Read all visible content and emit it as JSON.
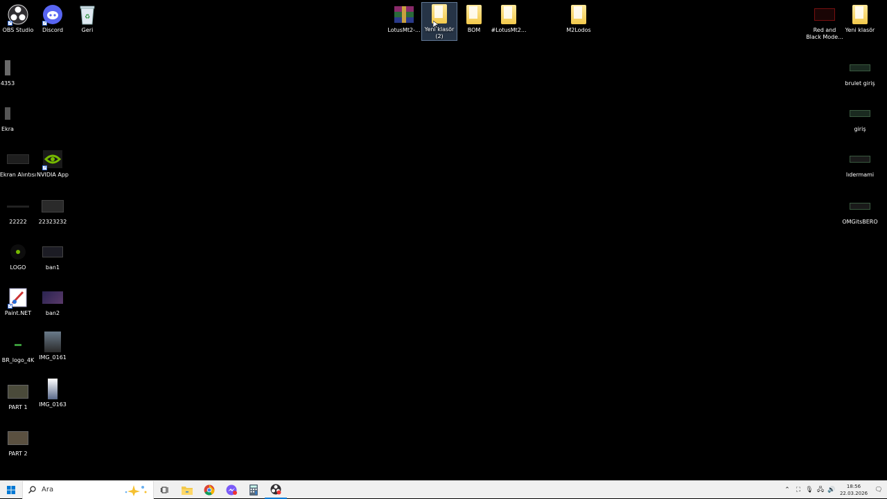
{
  "desktop": {
    "icons_left": [
      {
        "label": "OBS Studio"
      },
      {
        "label": "Discord"
      },
      {
        "label": "Geri"
      },
      {
        "label": "4353"
      },
      {
        "label": "Ekra"
      },
      {
        "label": "Ekran Alıntısı"
      },
      {
        "label": "NVIDIA App"
      },
      {
        "label": "22222"
      },
      {
        "label": "22323232"
      },
      {
        "label": "LOGO"
      },
      {
        "label": "ban1"
      },
      {
        "label": "Paint.NET"
      },
      {
        "label": "ban2"
      },
      {
        "label": "BR_logo_4K"
      },
      {
        "label": "IMG_0161"
      },
      {
        "label": "PART 1"
      },
      {
        "label": "IMG_0163"
      },
      {
        "label": "PART 2"
      }
    ],
    "icons_top": [
      {
        "label": "LotusMt2-..."
      },
      {
        "label": "Yeni klasör (2)"
      },
      {
        "label": "BOM"
      },
      {
        "label": "#LotusMt2..."
      },
      {
        "label": "M2Lodos"
      }
    ],
    "icons_right": [
      {
        "label": "Red and Black Mode..."
      },
      {
        "label": "Yeni klasör"
      },
      {
        "label": "brulet giriş"
      },
      {
        "label": "giriş"
      },
      {
        "label": "lıdermami"
      },
      {
        "label": "OMGitsBERO"
      }
    ]
  },
  "taskbar": {
    "search_placeholder": "Ara",
    "clock_time": "18:56",
    "clock_date": "22.03.2026"
  },
  "colors": {
    "desktop_bg": "#000000",
    "taskbar_bg": "#f0f0f0",
    "folder": "#f2c94c",
    "accent": "#0078d4"
  }
}
